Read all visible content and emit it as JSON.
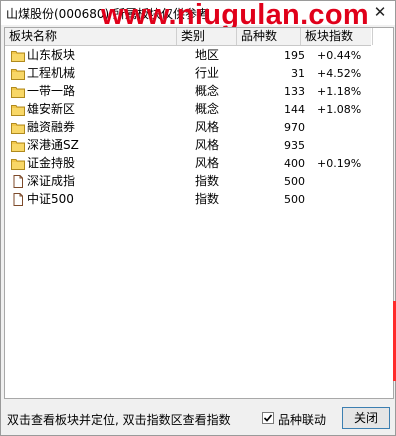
{
  "window": {
    "title": "山煤股份(000680)  所属板块仅供参考",
    "watermark": "www.niugulan.com"
  },
  "list": {
    "columns": [
      "板块名称",
      "类别",
      "品种数",
      "板块指数"
    ],
    "rows": [
      {
        "name": "山东板块",
        "type": "地区",
        "count": "195",
        "index": "+0.44%",
        "icon": "folder-icon"
      },
      {
        "name": "工程机械",
        "type": "行业",
        "count": "31",
        "index": "+4.52%",
        "icon": "folder-icon"
      },
      {
        "name": "一带一路",
        "type": "概念",
        "count": "133",
        "index": "+1.18%",
        "icon": "folder-icon"
      },
      {
        "name": "雄安新区",
        "type": "概念",
        "count": "144",
        "index": "+1.08%",
        "icon": "folder-icon"
      },
      {
        "name": "融资融券",
        "type": "风格",
        "count": "970",
        "index": "",
        "icon": "folder-icon"
      },
      {
        "name": "深港通SZ",
        "type": "风格",
        "count": "935",
        "index": "",
        "icon": "folder-icon"
      },
      {
        "name": "证金持股",
        "type": "风格",
        "count": "400",
        "index": "+0.19%",
        "icon": "folder-icon"
      },
      {
        "name": "深证成指",
        "type": "指数",
        "count": "500",
        "index": "",
        "icon": "document-icon"
      },
      {
        "name": "中证500",
        "type": "指数",
        "count": "500",
        "index": "",
        "icon": "document-icon"
      }
    ]
  },
  "footer": {
    "status": "双击查看板块并定位, 双击指数区查看指数",
    "checkbox_label": "品种联动",
    "checkbox_checked": true,
    "close_label": "关闭"
  },
  "colors": {
    "watermark": "#e0001a",
    "folder": "#f3c84b"
  }
}
